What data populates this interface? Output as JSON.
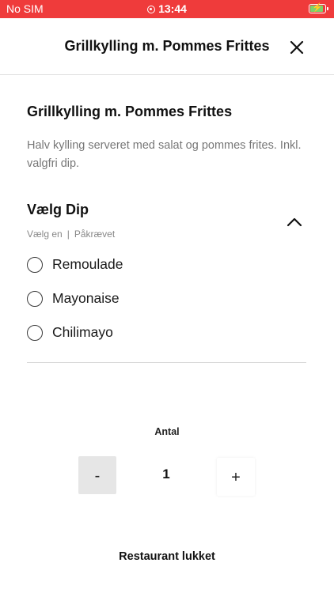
{
  "status_bar": {
    "carrier": "No SIM",
    "time": "13:44",
    "bolt_symbol": "⚡",
    "battery_level": 0.9,
    "background_color": "#ef3b3b",
    "battery_fill_color": "#7bd36b"
  },
  "header": {
    "title": "Grillkylling m. Pommes Frittes",
    "close_icon": "close-icon"
  },
  "product": {
    "title": "Grillkylling m. Pommes Frittes",
    "description": "Halv kylling serveret med salat og pommes frites. Inkl. valgfri dip."
  },
  "dip_section": {
    "title": "Vælg Dip",
    "rule": "Vælg en",
    "separator": "|",
    "requirement": "Påkrævet",
    "collapse_icon": "chevron-up-icon",
    "options": [
      {
        "label": "Remoulade",
        "selected": false
      },
      {
        "label": "Mayonaise",
        "selected": false
      },
      {
        "label": "Chilimayo",
        "selected": false
      }
    ]
  },
  "quantity": {
    "label": "Antal",
    "value": "1",
    "minus_label": "-",
    "plus_label": "+"
  },
  "footer": {
    "status_text": "Restaurant lukket"
  }
}
